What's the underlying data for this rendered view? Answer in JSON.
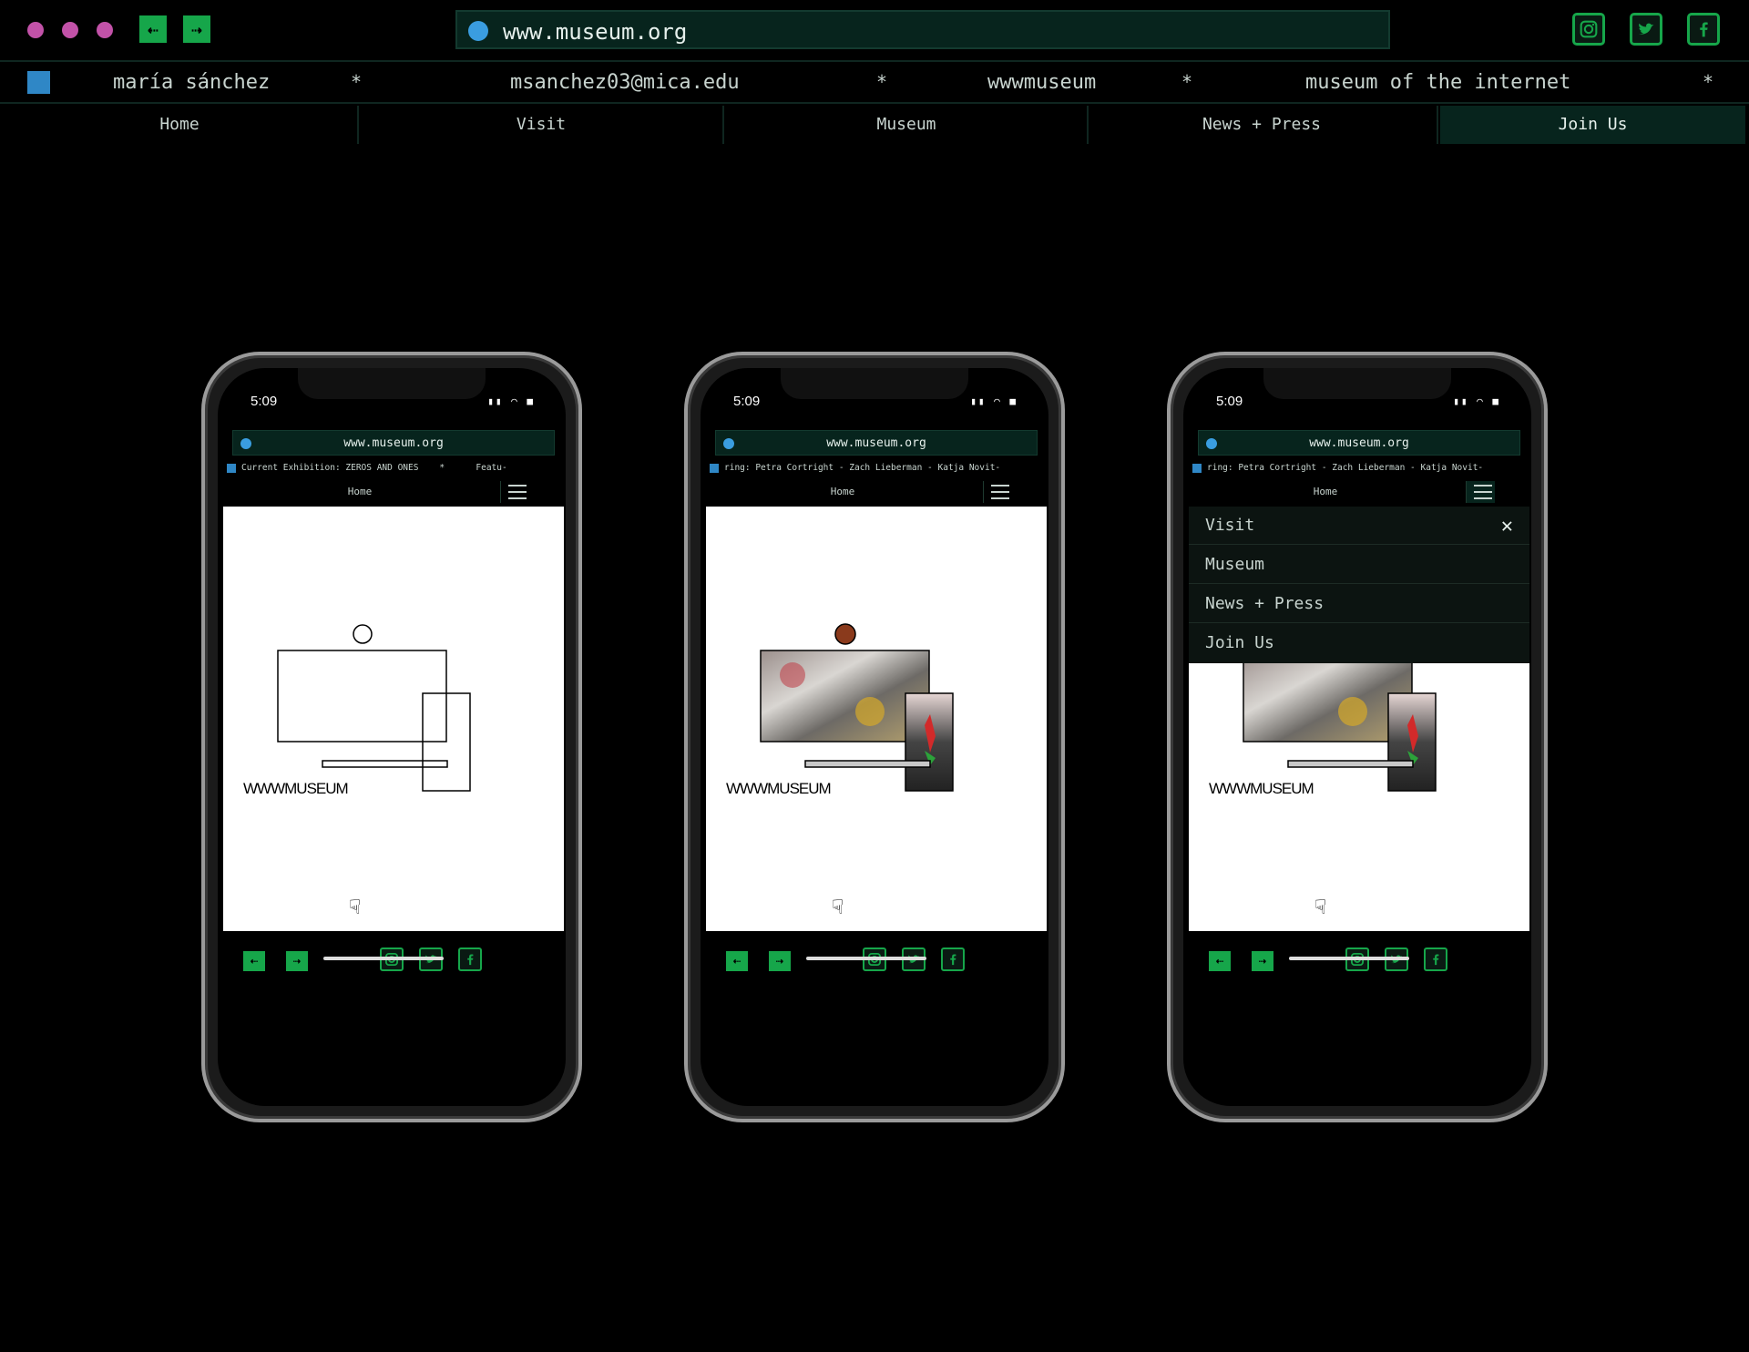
{
  "browser": {
    "url": "www.museum.org",
    "back_symbol": "⇠",
    "forward_symbol": "⇢"
  },
  "infobar": {
    "name": "maría sánchez",
    "email": "msanchez03@mica.edu",
    "handle": "wwwmuseum",
    "tagline": "museum of the internet",
    "separator": "*"
  },
  "nav": {
    "items": [
      "Home",
      "Visit",
      "Museum",
      "News + Press",
      "Join Us"
    ],
    "active_index": 4
  },
  "phones": [
    {
      "time": "5:09",
      "url": "www.museum.org",
      "ticker": "Current Exhibition: ZEROS AND ONES    *      Featu-",
      "page": "Home",
      "logo": "WWWMUSEUM"
    },
    {
      "time": "5:09",
      "url": "www.museum.org",
      "ticker": "ring: Petra Cortright - Zach Lieberman - Katja Novit-",
      "page": "Home",
      "logo": "WWWMUSEUM"
    },
    {
      "time": "5:09",
      "url": "www.museum.org",
      "ticker": "ring: Petra Cortright - Zach Lieberman - Katja Novit-",
      "page": "Home",
      "logo": "WWWMUSEUM",
      "menu": [
        "Visit",
        "Museum",
        "News + Press",
        "Join Us"
      ],
      "close_symbol": "✕"
    }
  ],
  "colors": {
    "accent_green": "#16a64a",
    "url_bg": "#07241d",
    "dot_magenta": "#c252a8",
    "dot_blue": "#3a9de0",
    "square_blue": "#2f87c6"
  },
  "icons": [
    "instagram-icon",
    "twitter-icon",
    "facebook-icon",
    "back-arrow-icon",
    "forward-arrow-icon",
    "hamburger-icon",
    "pointing-hand-icon",
    "close-icon"
  ]
}
